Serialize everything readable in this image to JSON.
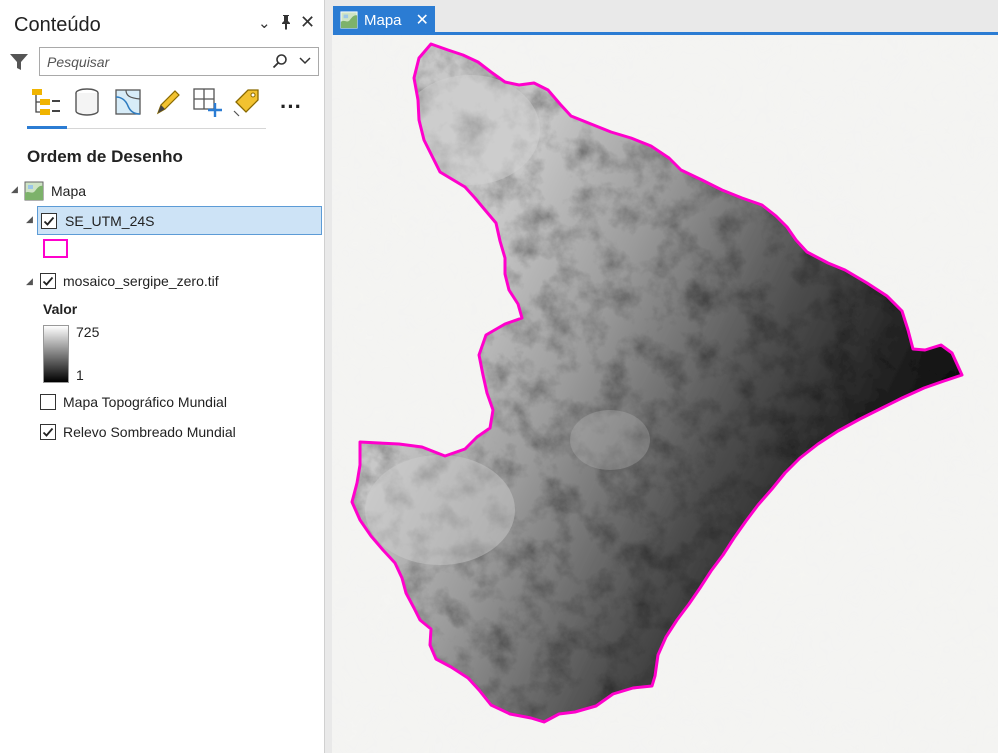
{
  "contents_pane": {
    "title": "Conteúdo",
    "search": {
      "placeholder": "Pesquisar"
    },
    "toolbar_icons": [
      "drawing-order-icon",
      "data-source-icon",
      "selection-icon",
      "editing-icon",
      "snapping-icon",
      "labeling-icon",
      "more-icon"
    ],
    "section_heading": "Ordem de Desenho",
    "tree": {
      "map": {
        "label": "Mapa"
      },
      "layers": [
        {
          "label": "SE_UTM_24S",
          "checked": true,
          "selected": true,
          "symbol_color": "#ff00cc"
        },
        {
          "label": "mosaico_sergipe_zero.tif",
          "checked": true,
          "legend": {
            "heading": "Valor",
            "high": "725",
            "low": "1"
          }
        },
        {
          "label": "Mapa Topográfico Mundial",
          "checked": false
        },
        {
          "label": "Relevo Sombreado Mundial",
          "checked": true
        }
      ]
    }
  },
  "map_view": {
    "tab_label": "Mapa",
    "boundary_color": "#ff00cc",
    "accent_color": "#2b7cd3"
  }
}
